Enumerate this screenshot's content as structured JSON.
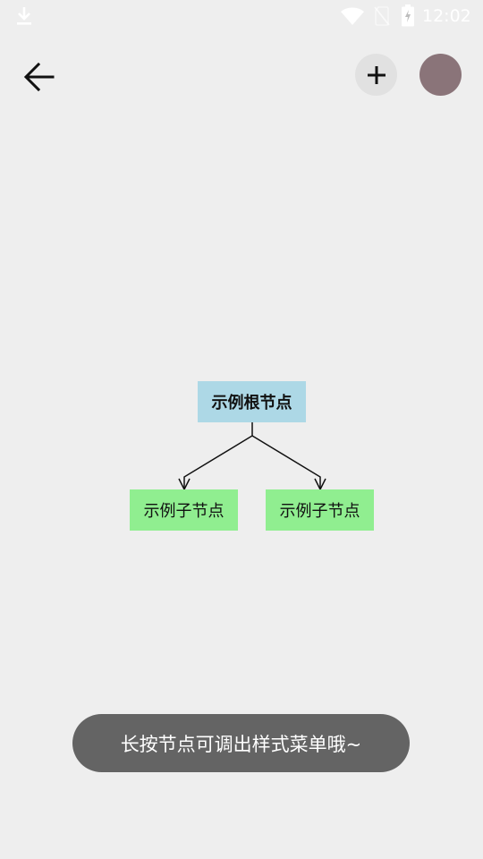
{
  "status_bar": {
    "time": "12:02",
    "icons": [
      "download-icon",
      "wifi-icon",
      "no-sim-icon",
      "battery-charging-icon"
    ]
  },
  "toolbar": {
    "back_icon": "arrow-left-icon",
    "add_icon": "plus-icon",
    "color_swatch": "#8a7479"
  },
  "mindmap": {
    "root": {
      "label": "示例根节点",
      "color": "#add8e6"
    },
    "children": [
      {
        "label": "示例子节点",
        "color": "#90ee90"
      },
      {
        "label": "示例子节点",
        "color": "#90ee90"
      }
    ]
  },
  "toast": {
    "message": "长按节点可调出样式菜单哦~"
  },
  "colors": {
    "background": "#eeeeee",
    "toast_background": "#646464",
    "add_button_background": "#e1e1e1"
  }
}
